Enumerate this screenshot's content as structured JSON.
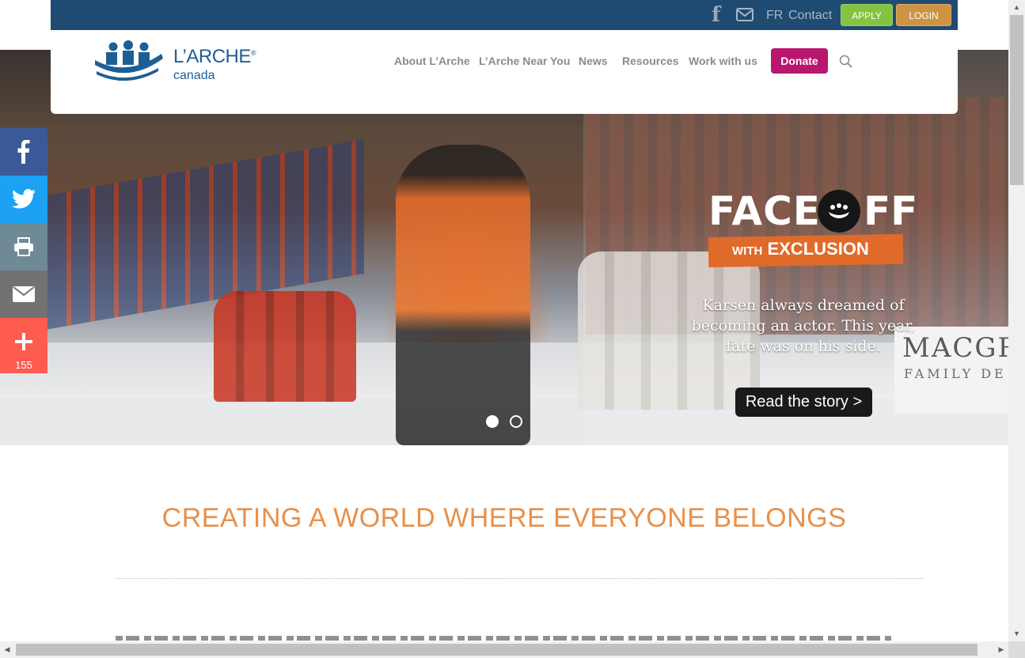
{
  "utility_bar": {
    "facebook_icon": "facebook-icon",
    "mail_icon": "mail-icon",
    "lang_label": "FR",
    "contact_label": "Contact",
    "apply_label": "APPLY",
    "login_label": "LOGIN",
    "colors": {
      "bar": "#1f4b73",
      "apply": "#83c341",
      "login": "#cd9443"
    }
  },
  "header": {
    "logo_title": "L’ARCHE",
    "logo_registered": "®",
    "logo_subtitle": "canada",
    "nav": [
      {
        "label": "About L’Arche"
      },
      {
        "label": "L’Arche Near You"
      },
      {
        "label": "News"
      },
      {
        "label": "Resources"
      },
      {
        "label": "Work with us"
      }
    ],
    "donate_label": "Donate",
    "donate_color": "#b8166f"
  },
  "share_bar": {
    "items": [
      {
        "icon": "facebook-icon",
        "color": "#3b5998"
      },
      {
        "icon": "twitter-icon",
        "color": "#1da1f2"
      },
      {
        "icon": "print-icon",
        "color": "#6d8a96"
      },
      {
        "icon": "email-icon",
        "color": "#727272"
      },
      {
        "icon": "plus-icon",
        "color": "#fd5c4f"
      }
    ],
    "share_count": "155"
  },
  "hero": {
    "campaign_title_part1": "FACE",
    "campaign_title_part2": "FF",
    "campaign_tagline_small": "WITH",
    "campaign_tagline": "EXCLUSION",
    "caption": "Karsen always dreamed of becoming an actor. This year, fate was on his side.",
    "cta_label": "Read the story >",
    "sign_big": "MACGR",
    "sign_small": "FAMILY DE",
    "slides_total": 2,
    "slide_active": 1
  },
  "main": {
    "headline": "CREATING A WORLD WHERE EVERYONE BELONGS",
    "headline_color": "#e8904a"
  }
}
